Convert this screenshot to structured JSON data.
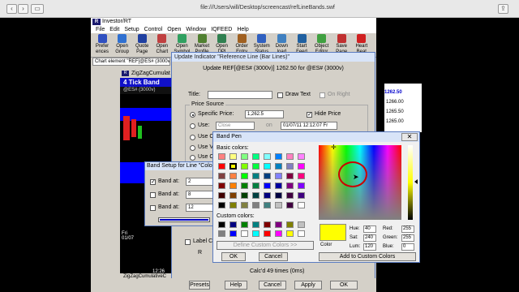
{
  "browser": {
    "url": "file:///Users/will/Desktop/screencast/refLineBands.swf"
  },
  "app": {
    "title": "Investor/RT",
    "menu": [
      "File",
      "Edit",
      "Setup",
      "Control",
      "Open",
      "Window",
      "IQFEED",
      "Help"
    ],
    "toolbar": [
      {
        "label": "Prefer ences",
        "color": "#3050c0"
      },
      {
        "label": "Open Group",
        "color": "#3070d0"
      },
      {
        "label": "Quote Page",
        "color": "#2040a0"
      },
      {
        "label": "Open Chart",
        "color": "#c04040"
      },
      {
        "label": "Open Symbol",
        "color": "#30a060"
      },
      {
        "label": "Market Profile",
        "color": "#508030"
      },
      {
        "label": "Open DPI",
        "color": "#308050"
      },
      {
        "label": "Order Entry",
        "color": "#a06020"
      },
      {
        "label": "System Status",
        "color": "#3060c0"
      },
      {
        "label": "Down load",
        "color": "#4080c0"
      },
      {
        "label": "Start Feed",
        "color": "#2060a0"
      },
      {
        "label": "Object Editor",
        "color": "#40a040"
      },
      {
        "label": "Save Page",
        "color": "#c03030"
      },
      {
        "label": "Heart Beat",
        "color": "#d02020"
      }
    ],
    "chart_element": "Chart element \"REF[@ES# (3000v)"
  },
  "chart": {
    "title": "ZigZagCumulat",
    "band_label": "4 Tick Band",
    "symbol": "@ES# (3000v)",
    "date_label": "Fri 01/07",
    "time_label": "12:26",
    "footer_label": "ZigZagCumulativeC",
    "right_prices": [
      "1262.50",
      "1266.00",
      "1265.50",
      "1265.00"
    ],
    "right_symbol": "@ES# (3000v)"
  },
  "dialog": {
    "title": "Update Indicator \"Reference Line (Bar Lines)\"",
    "heading": "Update REF[@ES# (3000v)] 1262.50 for @ES# (3000v)",
    "title_label": "Title:",
    "draw_text": "Draw Text",
    "on_right": "On Right",
    "price_source": "Price Source",
    "specific_price_label": "Specific Price:",
    "specific_price_value": "1,262.5",
    "hide_price": "Hide Price",
    "use_label": "Use:",
    "use_value": "Close",
    "on_label": "on",
    "date_value": "01/07/11 12:12:07 Fr",
    "use_cu": "Use Cu",
    "use_v": "Use V",
    "use_cl": "Use Cl",
    "label_c": "Label C",
    "r_label": "R",
    "calc_text": "Calc'd 49 times (0ms)",
    "buttons": {
      "presets": "Presets",
      "help": "Help",
      "cancel": "Cancel",
      "apply": "Apply",
      "ok": "OK"
    }
  },
  "band_setup": {
    "title": "Band Setup for Line \"Color",
    "rows": [
      {
        "label": "Band at:",
        "value": "2",
        "checked": true
      },
      {
        "label": "Band at:",
        "value": "8",
        "checked": false
      },
      {
        "label": "Band at:",
        "value": "12",
        "checked": false
      }
    ]
  },
  "band_pen": {
    "title": "Band Pen",
    "basic_colors_label": "Basic colors:",
    "custom_colors_label": "Custom colors:",
    "define_custom": "Define Custom Colors >>",
    "ok": "OK",
    "cancel": "Cancel",
    "color_label": "Color",
    "hue_label": "Hue:",
    "hue": "40",
    "sat_label": "Sat:",
    "sat": "240",
    "lum_label": "Lum:",
    "lum": "120",
    "red_label": "Red:",
    "red": "255",
    "green_label": "Green:",
    "green": "255",
    "blue_label": "Blue:",
    "blue": "0",
    "add_custom": "Add to Custom Colors",
    "basic_colors": [
      "#ff8080",
      "#ffff80",
      "#80ff80",
      "#00ff80",
      "#80ffff",
      "#0080ff",
      "#ff80c0",
      "#ff80ff",
      "#ff0000",
      "#ffff00",
      "#80ff00",
      "#00ff40",
      "#00ffff",
      "#0080c0",
      "#8080c0",
      "#ff00ff",
      "#804040",
      "#ff8040",
      "#00ff00",
      "#008080",
      "#004080",
      "#8080ff",
      "#800040",
      "#ff0080",
      "#800000",
      "#ff8000",
      "#008000",
      "#008040",
      "#0000ff",
      "#0000a0",
      "#800080",
      "#8000ff",
      "#400000",
      "#804000",
      "#004000",
      "#004040",
      "#000080",
      "#000040",
      "#400040",
      "#400080",
      "#000000",
      "#808000",
      "#808040",
      "#808080",
      "#408080",
      "#c0c0c0",
      "#400040",
      "#ffffff"
    ],
    "custom_colors": [
      "#000000",
      "#000080",
      "#008000",
      "#008080",
      "#800000",
      "#800080",
      "#808000",
      "#c0c0c0",
      "#808080",
      "#0000ff",
      "#ffffff",
      "#00ffff",
      "#ff0000",
      "#ff00ff",
      "#ffff00",
      "#ffffff"
    ],
    "selected_color": "#ffff00"
  }
}
